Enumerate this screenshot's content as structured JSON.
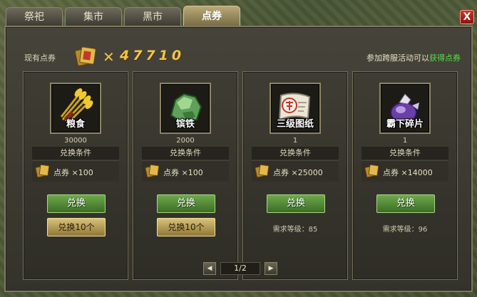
{
  "tabs": [
    {
      "label": "祭祀",
      "active": false
    },
    {
      "label": "集市",
      "active": false
    },
    {
      "label": "黑市",
      "active": false
    },
    {
      "label": "点券",
      "active": true
    }
  ],
  "close_label": "X",
  "header": {
    "coupon_label": "现有点券",
    "times_sign": "✕",
    "coupon_amount": "47710",
    "event_note_prefix": "参加跨服活动可以",
    "event_note_link": "获得点券"
  },
  "items": [
    {
      "name": "粮食",
      "icon": "grain-icon",
      "quantity": "30000",
      "condition_title": "兑换条件",
      "cost_text": "点券 ×100",
      "exchange_label": "兑换",
      "exchange10_label": "兑换10个",
      "level_req": ""
    },
    {
      "name": "镔铁",
      "icon": "iron-icon",
      "quantity": "2000",
      "condition_title": "兑换条件",
      "cost_text": "点券 ×100",
      "exchange_label": "兑换",
      "exchange10_label": "兑换10个",
      "level_req": ""
    },
    {
      "name": "三级图纸",
      "icon": "blueprint-scroll-icon",
      "quantity": "1",
      "condition_title": "兑换条件",
      "cost_text": "点券 ×25000",
      "exchange_label": "兑换",
      "exchange10_label": "",
      "level_req": "需求等级：85"
    },
    {
      "name": "霸下碎片",
      "icon": "fragment-pot-icon",
      "quantity": "1",
      "condition_title": "兑换条件",
      "cost_text": "点券 ×14000",
      "exchange_label": "兑换",
      "exchange10_label": "",
      "level_req": "需求等级：96"
    }
  ],
  "pager": {
    "prev": "◀",
    "page_text": "1/2",
    "next": "▶"
  },
  "colors": {
    "accent_gold": "#f4c44a",
    "link_green": "#54e04a",
    "button_green": "#6ea94c"
  }
}
